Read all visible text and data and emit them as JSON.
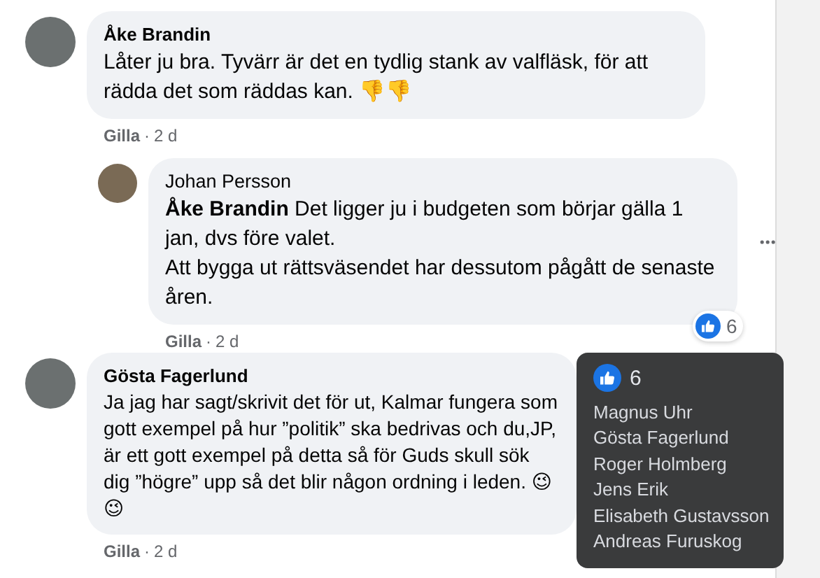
{
  "comments": [
    {
      "kind": "comment",
      "author": "Åke Brandin",
      "text": "Låter ju bra. Tyvärr är det en tydlig stank av valfläsk, för att rädda det som räddas kan. 👎👎",
      "like_label": "Gilla",
      "separator": "·",
      "time": "2 d"
    },
    {
      "kind": "reply",
      "author": "Johan Persson",
      "text": "**Åke Brandin** Det ligger ju i budgeten som börjar gälla 1 jan, dvs före valet.\nAtt bygga ut rättsväsendet har dessutom pågått de senaste åren.",
      "like_label": "Gilla",
      "separator": "·",
      "time": "2 d",
      "reaction_count": "6"
    },
    {
      "kind": "comment",
      "author": "Gösta Fagerlund",
      "text": "Ja jag har sagt/skrivit det för ut, Kalmar fungera som gott exempel på hur ”politik” ska bedrivas och du,JP, är ett gott exempel på detta så för Guds skull sök dig ”högre” upp så det blir någon ordning i leden. 😉😉",
      "like_label": "Gilla",
      "separator": "·",
      "time": "2 d"
    }
  ],
  "tooltip": {
    "count": "6",
    "names": [
      "Magnus Uhr",
      "Gösta Fagerlund",
      "Roger Holmberg",
      "Jens Erik",
      "Elisabeth Gustavsson",
      "Andreas Furuskog"
    ]
  }
}
